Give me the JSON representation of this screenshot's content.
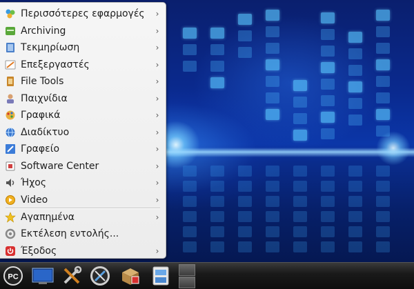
{
  "menu": {
    "items": [
      {
        "label": "Περισσότερες εφαρμογές",
        "icon": "more-apps-icon",
        "has_submenu": true
      },
      {
        "label": "Archiving",
        "icon": "archive-icon",
        "has_submenu": true
      },
      {
        "label": "Τεκμηρίωση",
        "icon": "documentation-icon",
        "has_submenu": true
      },
      {
        "label": "Επεξεργαστές",
        "icon": "editors-icon",
        "has_submenu": true
      },
      {
        "label": "File Tools",
        "icon": "file-tools-icon",
        "has_submenu": true
      },
      {
        "label": "Παιχνίδια",
        "icon": "games-icon",
        "has_submenu": true
      },
      {
        "label": "Γραφικά",
        "icon": "graphics-icon",
        "has_submenu": true
      },
      {
        "label": "Διαδίκτυο",
        "icon": "internet-icon",
        "has_submenu": true
      },
      {
        "label": "Γραφείο",
        "icon": "office-icon",
        "has_submenu": true
      },
      {
        "label": "Software Center",
        "icon": "software-center-icon",
        "has_submenu": true
      },
      {
        "label": "Ήχος",
        "icon": "sound-icon",
        "has_submenu": true
      },
      {
        "label": "Video",
        "icon": "video-icon",
        "has_submenu": true
      },
      {
        "label": "Αγαπημένα",
        "icon": "favorites-icon",
        "has_submenu": true
      },
      {
        "label": "Εκτέλεση εντολής...",
        "icon": "run-command-icon",
        "has_submenu": false
      },
      {
        "label": "Έξοδος",
        "icon": "logout-icon",
        "has_submenu": true
      }
    ],
    "arrow_glyph": "›"
  },
  "taskbar": {
    "start_label": "PC",
    "icons": [
      "start-menu-icon",
      "desktop-icon",
      "system-settings-icon",
      "preferences-icon",
      "package-installer-icon",
      "file-manager-icon",
      "pager-icon"
    ]
  },
  "colors": {
    "menu_bg": "#f2f2f2",
    "taskbar_bg": "#161616",
    "wallpaper_blue": "#0b36a8"
  }
}
